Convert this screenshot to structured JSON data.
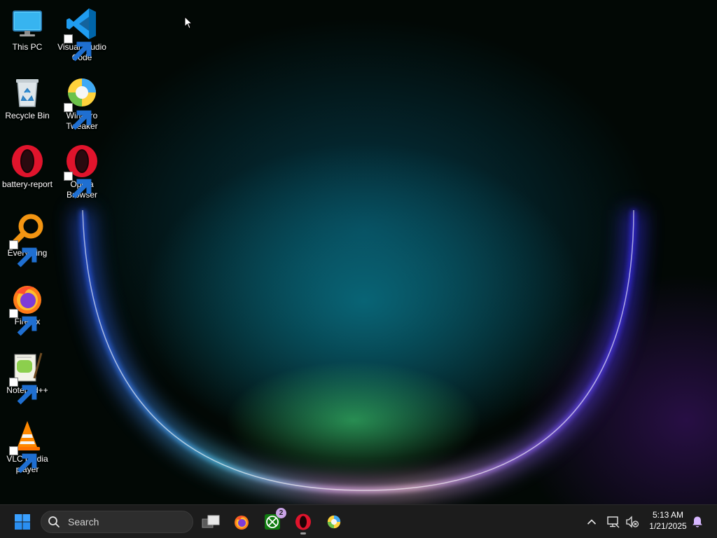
{
  "desktop": {
    "icons": [
      {
        "label": "This PC",
        "icon": "this-pc-icon",
        "shortcut": false
      },
      {
        "label": "Visual Studio Code",
        "icon": "vscode-icon",
        "shortcut": true
      },
      {
        "label": "Recycle Bin",
        "icon": "recycle-bin-icon",
        "shortcut": false
      },
      {
        "label": "Winaero Tweaker",
        "icon": "winaero-tweaker-icon",
        "shortcut": true
      },
      {
        "label": "battery-report",
        "icon": "opera-icon",
        "shortcut": false
      },
      {
        "label": "Opera Browser",
        "icon": "opera-icon",
        "shortcut": true
      },
      {
        "label": "Everything",
        "icon": "everything-icon",
        "shortcut": true
      },
      {
        "label": "Firefox",
        "icon": "firefox-icon",
        "shortcut": true
      },
      {
        "label": "Notepad++",
        "icon": "notepadpp-icon",
        "shortcut": true
      },
      {
        "label": "VLC media player",
        "icon": "vlc-icon",
        "shortcut": true
      }
    ]
  },
  "taskbar": {
    "start_icon": "windows-start-icon",
    "search": {
      "placeholder": "Search",
      "value": ""
    },
    "apps": [
      {
        "name": "Task View",
        "icon": "task-view-icon"
      },
      {
        "name": "Firefox",
        "icon": "firefox-icon"
      },
      {
        "name": "Xbox",
        "icon": "xbox-icon",
        "badge": "2"
      },
      {
        "name": "Opera",
        "icon": "opera-icon",
        "running": true
      },
      {
        "name": "Winaero Tweaker",
        "icon": "winaero-tweaker-icon"
      }
    ],
    "tray": {
      "overflow_icon": "chevron-up-icon",
      "network_icon": "network-icon",
      "volume_icon": "volume-muted-icon",
      "notification_icon": "notification-bell-icon"
    },
    "clock": {
      "time": "5:13 AM",
      "date": "1/21/2025"
    }
  },
  "colors": {
    "taskbar_bg": "#1c1c1c",
    "accent_blue": "#1e90ff",
    "badge": "#c9a3e6"
  }
}
